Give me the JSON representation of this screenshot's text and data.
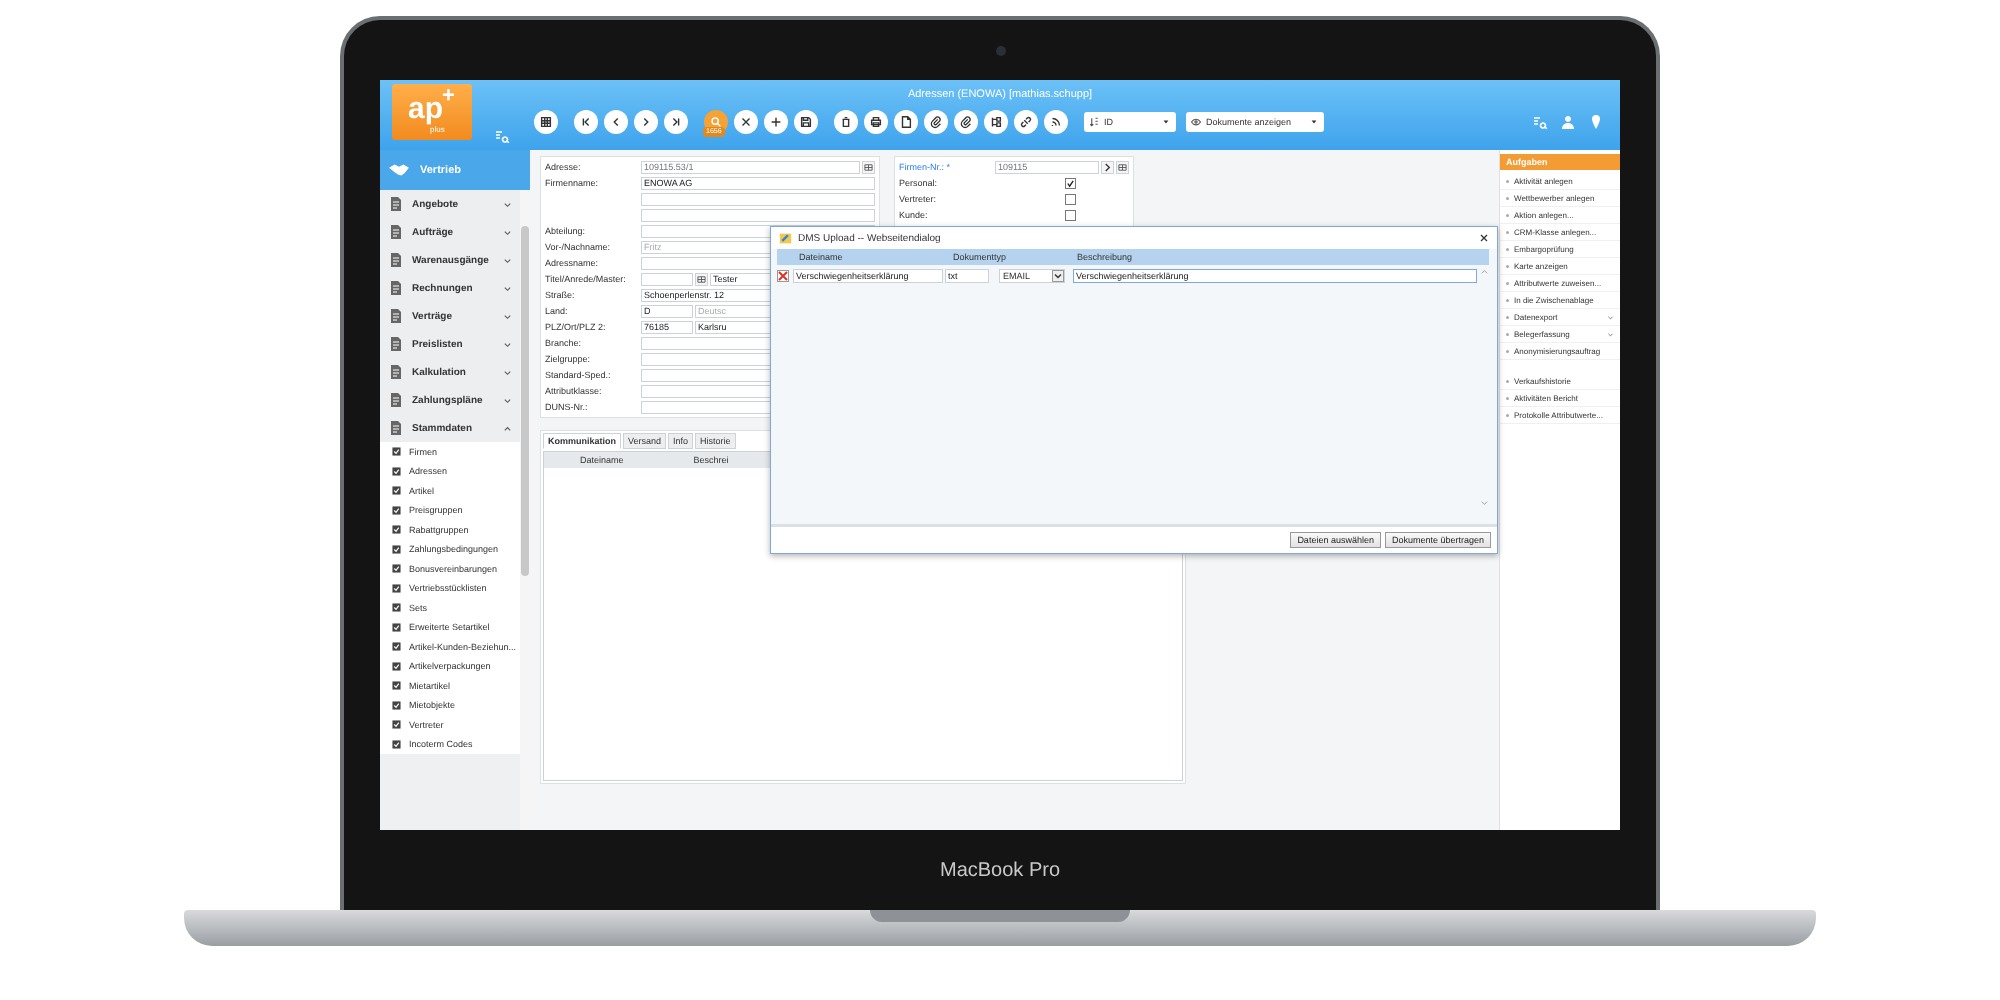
{
  "laptop_label": "MacBook Pro",
  "app": {
    "title": "Adressen (ENOWA) [mathias.schupp]",
    "logo": "ap",
    "logo_plus": "+",
    "logo_sub": "plus"
  },
  "toolbar": [
    {
      "kind": "grid"
    },
    {
      "kind": "first"
    },
    {
      "kind": "prev"
    },
    {
      "kind": "next"
    },
    {
      "kind": "last"
    },
    {
      "kind": "search",
      "badge": "1656"
    },
    {
      "kind": "close"
    },
    {
      "kind": "add"
    },
    {
      "kind": "save"
    },
    {
      "kind": "delete"
    },
    {
      "kind": "print"
    },
    {
      "kind": "document"
    },
    {
      "kind": "attach"
    },
    {
      "kind": "attach"
    },
    {
      "kind": "tree"
    },
    {
      "kind": "link"
    },
    {
      "kind": "rss"
    }
  ],
  "selects": [
    {
      "kind": "sort",
      "value": "ID"
    },
    {
      "kind": "eye",
      "value": "Dokumente anzeigen"
    }
  ],
  "sidebar": {
    "title": "Vertrieb",
    "groups": [
      {
        "label": "Angebote",
        "expanded": false
      },
      {
        "label": "Aufträge",
        "expanded": false
      },
      {
        "label": "Warenausgänge",
        "expanded": false
      },
      {
        "label": "Rechnungen",
        "expanded": false
      },
      {
        "label": "Verträge",
        "expanded": false
      },
      {
        "label": "Preislisten",
        "expanded": false
      },
      {
        "label": "Kalkulation",
        "expanded": false
      },
      {
        "label": "Zahlungspläne",
        "expanded": false
      },
      {
        "label": "Stammdaten",
        "expanded": true,
        "children": [
          {
            "label": "Firmen"
          },
          {
            "label": "Adressen"
          },
          {
            "label": "Artikel"
          },
          {
            "label": "Preisgruppen"
          },
          {
            "label": "Rabattgruppen"
          },
          {
            "label": "Zahlungsbedingungen"
          },
          {
            "label": "Bonusvereinbarungen"
          },
          {
            "label": "Vertriebsstücklisten"
          },
          {
            "label": "Sets"
          },
          {
            "label": "Erweiterte Setartikel"
          },
          {
            "label": "Artikel-Kunden-Beziehun..."
          },
          {
            "label": "Artikelverpackungen"
          },
          {
            "label": "Mietartikel"
          },
          {
            "label": "Mietobjekte"
          },
          {
            "label": "Vertreter"
          },
          {
            "label": "Incoterm Codes"
          }
        ]
      }
    ]
  },
  "form": {
    "rows": [
      {
        "label": "Adresse:",
        "fields": [
          {
            "kind": "readonly",
            "value": "109115.53/1"
          },
          {
            "kind": "picker"
          }
        ]
      },
      {
        "label": "Firmenname:",
        "fields": [
          {
            "kind": "text",
            "value": "ENOWA AG"
          }
        ]
      },
      {
        "fields": [
          {
            "kind": "text"
          }
        ]
      },
      {
        "fields": [
          {
            "kind": "text"
          }
        ]
      },
      {
        "label": "Abteilung:",
        "fields": [
          {
            "kind": "text"
          }
        ]
      },
      {
        "label": "Vor-/Nachname:",
        "fields": [
          {
            "kind": "text",
            "placeholder": "Fritz"
          }
        ]
      },
      {
        "label": "Adressname:",
        "fields": [
          {
            "kind": "text"
          }
        ]
      },
      {
        "label": "Titel/Anrede/Master:",
        "fields": [
          {
            "kind": "text"
          },
          {
            "kind": "picker"
          },
          {
            "kind": "text",
            "value": "Tester"
          }
        ]
      },
      {
        "label": "Straße:",
        "fields": [
          {
            "kind": "text",
            "value": "Schoenperlenstr. 12"
          }
        ]
      },
      {
        "label": "Land:",
        "fields": [
          {
            "kind": "text",
            "value": "D"
          },
          {
            "kind": "text",
            "placeholder": "Deutsc"
          }
        ]
      },
      {
        "label": "PLZ/Ort/PLZ 2:",
        "fields": [
          {
            "kind": "text",
            "value": "76185"
          },
          {
            "kind": "text",
            "value": "Karlsru"
          }
        ]
      },
      {
        "label": "Branche:",
        "fields": [
          {
            "kind": "text"
          }
        ]
      },
      {
        "label": "Zielgruppe:",
        "fields": [
          {
            "kind": "text"
          }
        ]
      },
      {
        "label": "Standard-Sped.:",
        "fields": [
          {
            "kind": "text"
          }
        ]
      },
      {
        "label": "Attributklasse:",
        "fields": [
          {
            "kind": "text"
          }
        ]
      },
      {
        "label": "DUNS-Nr.:",
        "fields": [
          {
            "kind": "text"
          }
        ]
      }
    ],
    "side_rows": [
      {
        "label": "Firmen-Nr.: *",
        "required": true,
        "fields": [
          {
            "kind": "readonly",
            "value": "109115"
          },
          {
            "kind": "next"
          },
          {
            "kind": "picker"
          }
        ]
      },
      {
        "label": "Personal:",
        "required": false,
        "checked": true
      },
      {
        "label": "Vertreter:",
        "required": false,
        "checked": false
      },
      {
        "label": "Kunde:",
        "required": false,
        "checked": false
      }
    ]
  },
  "tabs": [
    {
      "label": "Kommunikation",
      "selected": true
    },
    {
      "label": "Versand",
      "selected": false
    },
    {
      "label": "Info",
      "selected": false
    },
    {
      "label": "Historie",
      "selected": false
    }
  ],
  "tab_table": {
    "columns": [
      "Dateiname",
      "Beschrei"
    ]
  },
  "dialog": {
    "title": "DMS Upload -- Webseitendialog",
    "columns": [
      "Dateiname",
      "Dokumenttyp",
      "Beschreibung"
    ],
    "rows": [
      {
        "filename": "Verschwiegenheitserklärung",
        "extension": "txt",
        "type": "EMAIL",
        "description": "Verschwiegenheitserklärung"
      }
    ],
    "buttons": [
      "Dateien auswählen",
      "Dokumente übertragen"
    ]
  },
  "tasks": {
    "title": "Aufgaben",
    "groups": [
      [
        {
          "label": "Aktivität anlegen",
          "kind": "action"
        },
        {
          "label": "Wettbewerber anlegen",
          "kind": "action"
        },
        {
          "label": "Aktion anlegen...",
          "kind": "action"
        },
        {
          "label": "CRM-Klasse anlegen...",
          "kind": "action"
        },
        {
          "label": "Embargoprüfung",
          "kind": "action"
        },
        {
          "label": "Karte anzeigen",
          "kind": "action"
        },
        {
          "label": "Attributwerte zuweisen...",
          "kind": "action"
        },
        {
          "label": "In die Zwischenablage",
          "kind": "action"
        },
        {
          "label": "Datenexport",
          "kind": "submenu"
        },
        {
          "label": "Belegerfassung",
          "kind": "submenu"
        },
        {
          "label": "Anonymisierungsauftrag",
          "kind": "action"
        }
      ],
      [
        {
          "label": "Verkaufshistorie",
          "kind": "action"
        },
        {
          "label": "Aktivitäten Bericht",
          "kind": "action"
        },
        {
          "label": "Protokolle Attributwerte...",
          "kind": "action"
        }
      ]
    ]
  }
}
